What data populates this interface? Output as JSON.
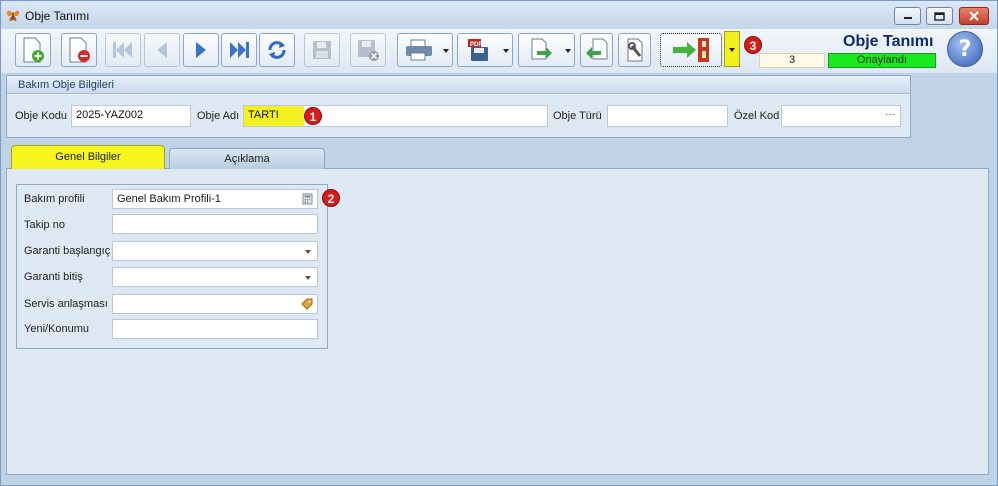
{
  "window": {
    "title": "Obje Tanımı",
    "controls": [
      "minimize",
      "maximize",
      "close"
    ]
  },
  "toolbar": {
    "buttons": [
      {
        "name": "new-document",
        "icon": "document-add-icon",
        "enabled": true
      },
      {
        "name": "delete-document",
        "icon": "document-delete-icon",
        "enabled": true
      },
      {
        "name": "first-record",
        "icon": "first-icon",
        "enabled": false
      },
      {
        "name": "previous-record",
        "icon": "previous-icon",
        "enabled": false
      },
      {
        "name": "next-record",
        "icon": "next-icon",
        "enabled": true
      },
      {
        "name": "last-record",
        "icon": "last-icon",
        "enabled": true
      },
      {
        "name": "refresh",
        "icon": "refresh-icon",
        "enabled": true
      },
      {
        "name": "save",
        "icon": "save-icon",
        "enabled": false
      },
      {
        "name": "save-cancel",
        "icon": "save-cancel-icon",
        "enabled": false
      },
      {
        "name": "print",
        "icon": "printer-icon",
        "has_dropdown": true
      },
      {
        "name": "pdf-export",
        "icon": "pdf-save-icon",
        "has_dropdown": true
      },
      {
        "name": "export",
        "icon": "export-icon",
        "has_dropdown": true
      },
      {
        "name": "import",
        "icon": "import-icon",
        "enabled": true
      },
      {
        "name": "settings",
        "icon": "wrench-icon",
        "enabled": true
      },
      {
        "name": "exit",
        "icon": "exit-door-icon",
        "has_dropdown": true,
        "highlighted": true
      }
    ]
  },
  "header": {
    "form_title": "Obje Tanımı",
    "record_count": "3",
    "status": "Onaylandı",
    "status_color": "#17e91c",
    "help_label": "?"
  },
  "object_info": {
    "group_title": "Bakım Obje Bilgileri",
    "fields": {
      "code_label": "Obje Kodu",
      "code_value": "2025-YAZ002",
      "name_label": "Obje Adı",
      "name_value": "TARTI",
      "type_label": "Obje Türü",
      "type_value": "",
      "special_label": "Özel Kod",
      "special_value": "",
      "special_ellipsis": "···"
    }
  },
  "tabs": [
    {
      "label": "Genel Bilgiler",
      "active": true,
      "highlight_color": "#f6f51e"
    },
    {
      "label": "Açıklama",
      "active": false
    }
  ],
  "general_info": {
    "fields": [
      {
        "label": "Bakım profili",
        "value": "Genel Bakım Profili-1",
        "control": "lookup"
      },
      {
        "label": "Takip no",
        "value": "",
        "control": "text"
      },
      {
        "label": "Garanti başlangıç",
        "value": "",
        "control": "dropdown"
      },
      {
        "label": "Garanti bitiş",
        "value": "",
        "control": "dropdown"
      },
      {
        "label": "Servis anlaşması",
        "value": "",
        "control": "tag-lookup"
      },
      {
        "label": "Yeni/Konumu",
        "value": "",
        "control": "text"
      }
    ]
  },
  "markers": [
    "1",
    "2",
    "3"
  ]
}
